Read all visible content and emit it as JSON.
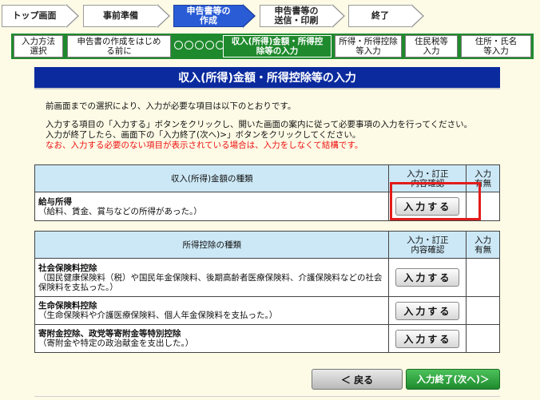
{
  "steps": [
    {
      "label": "トップ画面",
      "active": false
    },
    {
      "label": "事前準備",
      "active": false
    },
    {
      "label": "申告書等の\n作成",
      "active": true
    },
    {
      "label": "申告書等の\n送信・印刷",
      "active": false
    },
    {
      "label": "終了",
      "active": false
    }
  ],
  "substeps": [
    {
      "label": "入力方法\n選択",
      "active": false
    },
    {
      "label": "申告書の作成をはじめ\nる前に",
      "active": false
    },
    {
      "label": "収入(所得)金額・所得控\n除等の入力",
      "active": true
    },
    {
      "label": "所得・所得控除\n等入力",
      "active": false
    },
    {
      "label": "住民税等\n入力",
      "active": false
    },
    {
      "label": "住所・氏名\n等入力",
      "active": false
    }
  ],
  "title": "収入(所得)金額・所得控除等の入力",
  "description": {
    "line1": "前画面までの選択により、入力が必要な項目は以下のとおりです。",
    "line2": "入力する項目の「入力する」ボタンをクリックし、開いた画面の案内に従って必要事項の入力を行ってください。",
    "line3": "入力が終了したら、画面下の「入力終了(次へ)>」ボタンをクリックしてください。",
    "line4": "なお、入力する必要のない項目が表示されている場合は、入力をしなくて結構です。"
  },
  "income_table": {
    "header_type": "収入(所得)金額の種類",
    "header_check": "入力・訂正\n内容確認",
    "header_has": "入力\n有無",
    "rows": [
      {
        "title": "給与所得",
        "detail": "（給料、賃金、賞与などの所得があった。）",
        "button": "入力する"
      }
    ]
  },
  "deduction_table": {
    "header_type": "所得控除の種類",
    "header_check": "入力・訂正\n内容確認",
    "header_has": "入力\n有無",
    "rows": [
      {
        "title": "社会保険料控除",
        "detail": "（国民健康保険料（税）や国民年金保険料、後期高齢者医療保険料、介護保険料などの社会保険料を支払った。）",
        "button": "入力する"
      },
      {
        "title": "生命保険料控除",
        "detail": "（生命保険料や介護医療保険料、個人年金保険料を支払った。）",
        "button": "入力する"
      },
      {
        "title": "寄附金控除、政党等寄附金等特別控除",
        "detail": "（寄附金や特定の政治献金を支出した。）",
        "button": "入力する"
      }
    ]
  },
  "buttons": {
    "back": "＜ 戻る",
    "next": "入力終了(次へ)＞"
  },
  "colors": {
    "highlight": "#e21b1b",
    "active_step": "#2a5cd6",
    "sub_bar": "#1f8a2d"
  }
}
